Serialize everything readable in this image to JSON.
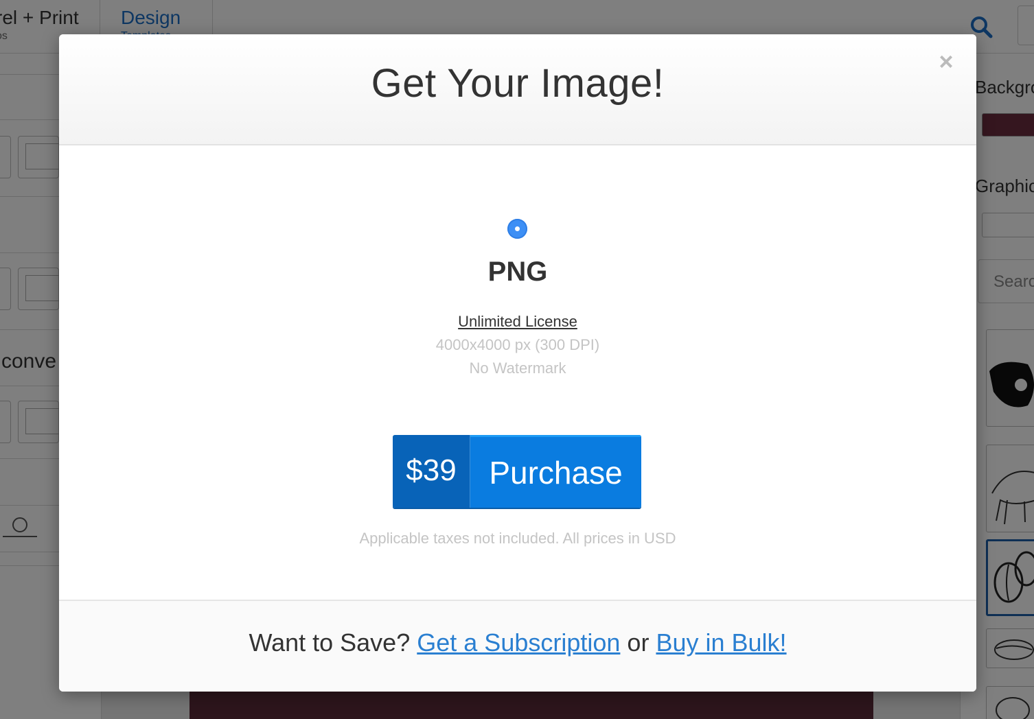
{
  "background_app": {
    "nav_apparel_title": "rel + Print",
    "nav_apparel_subtitle": "os",
    "nav_design_title": "Design",
    "nav_design_subtitle": "Templates",
    "left_panel_text": "conve",
    "right_panel_background_label": "Backgro",
    "right_panel_graphics_label": "Graphic",
    "right_panel_search_placeholder": "Searc",
    "background_swatch_color": "#6b2c3f"
  },
  "modal": {
    "title": "Get Your Image!",
    "close_label": "×",
    "format": "PNG",
    "license_link": "Unlimited License",
    "resolution": "4000x4000 px (300 DPI)",
    "watermark": "No Watermark",
    "purchase_price": "$39",
    "purchase_label": "Purchase",
    "taxes_note": "Applicable taxes not included. All prices in USD",
    "footer_prefix": "Want to Save?",
    "footer_subscription_link": "Get a Subscription",
    "footer_or": "or",
    "footer_bulk_link": "Buy in Bulk!"
  },
  "colors": {
    "accent": "#0a7ce0",
    "accent_dark": "#0863b8",
    "link": "#2a7fd1",
    "radio": "#3d8ff5"
  }
}
